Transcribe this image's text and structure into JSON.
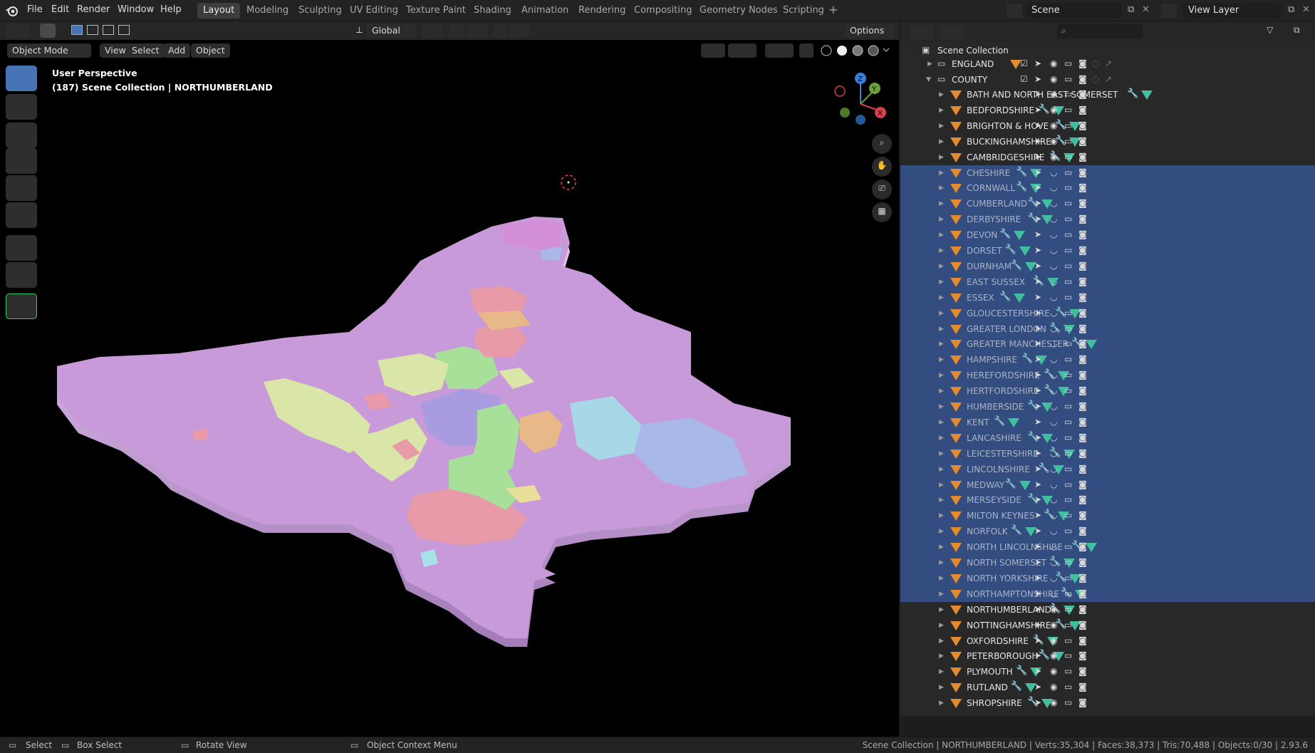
{
  "menu": {
    "file": "File",
    "edit": "Edit",
    "render": "Render",
    "window": "Window",
    "help": "Help"
  },
  "workspaces": [
    "Layout",
    "Modeling",
    "Sculpting",
    "UV Editing",
    "Texture Paint",
    "Shading",
    "Animation",
    "Rendering",
    "Compositing",
    "Geometry Nodes",
    "Scripting"
  ],
  "active_workspace": "Layout",
  "scene": {
    "label": "Scene",
    "view_layer": "View Layer"
  },
  "viewport_header": {
    "transform_orientation": "Global",
    "options": "Options",
    "mode": "Object Mode",
    "view": "View",
    "select": "Select",
    "add": "Add",
    "object": "Object"
  },
  "viewport_info": {
    "line1": "User Perspective",
    "line2": "(187) Scene Collection | NORTHUMBERLAND"
  },
  "outliner": {
    "root": "Scene Collection",
    "collections": [
      {
        "name": "ENGLAND"
      },
      {
        "name": "COUNTY"
      }
    ],
    "objects": [
      {
        "name": "BATH AND NORTH EAST SOMERSET",
        "selected": false
      },
      {
        "name": "BEDFORDSHIRE",
        "selected": false
      },
      {
        "name": "BRIGHTON & HOVE",
        "selected": false
      },
      {
        "name": "BUCKINGHAMSHIRE",
        "selected": false
      },
      {
        "name": "CAMBRIDGESHIRE",
        "selected": false
      },
      {
        "name": "CHESHIRE",
        "selected": true
      },
      {
        "name": "CORNWALL",
        "selected": true
      },
      {
        "name": "CUMBERLAND",
        "selected": true
      },
      {
        "name": "DERBYSHIRE",
        "selected": true
      },
      {
        "name": "DEVON",
        "selected": true
      },
      {
        "name": "DORSET",
        "selected": true
      },
      {
        "name": "DURNHAM",
        "selected": true
      },
      {
        "name": "EAST SUSSEX",
        "selected": true
      },
      {
        "name": "ESSEX",
        "selected": true
      },
      {
        "name": "GLOUCESTERSHIRE",
        "selected": true
      },
      {
        "name": "GREATER LONDON",
        "selected": true
      },
      {
        "name": "GREATER MANCHESTER",
        "selected": true
      },
      {
        "name": "HAMPSHIRE",
        "selected": true
      },
      {
        "name": "HEREFORDSHIRE",
        "selected": true
      },
      {
        "name": "HERTFORDSHIRE",
        "selected": true
      },
      {
        "name": "HUMBERSIDE",
        "selected": true
      },
      {
        "name": "KENT",
        "selected": true
      },
      {
        "name": "LANCASHIRE",
        "selected": true
      },
      {
        "name": "LEICESTERSHIRE",
        "selected": true
      },
      {
        "name": "LINCOLNSHIRE",
        "selected": true
      },
      {
        "name": "MEDWAY",
        "selected": true
      },
      {
        "name": "MERSEYSIDE",
        "selected": true
      },
      {
        "name": "MILTON KEYNES",
        "selected": true
      },
      {
        "name": "NORFOLK",
        "selected": true
      },
      {
        "name": "NORTH LINCOLNSHIRE",
        "selected": true
      },
      {
        "name": "NORTH SOMERSET",
        "selected": true
      },
      {
        "name": "NORTH YORKSHIRE",
        "selected": true
      },
      {
        "name": "NORTHAMPTONSHIRE",
        "selected": true
      },
      {
        "name": "NORTHUMBERLAND",
        "selected": false
      },
      {
        "name": "NOTTINGHAMSHIRE",
        "selected": false
      },
      {
        "name": "OXFORDSHIRE",
        "selected": false
      },
      {
        "name": "PETERBOROUGH",
        "selected": false
      },
      {
        "name": "PLYMOUTH",
        "selected": false
      },
      {
        "name": "RUTLAND",
        "selected": false
      },
      {
        "name": "SHROPSHIRE",
        "selected": false
      }
    ]
  },
  "status": {
    "select": "Select",
    "box_select": "Box Select",
    "rotate_view": "Rotate View",
    "context_menu": "Object Context Menu",
    "stats": "Scene Collection | NORTHUMBERLAND | Verts:35,304 | Faces:38,373 | Tris:70,488 | Objects:0/30 | 2.93.6"
  },
  "colors": {
    "selection_blue": "#334d80",
    "active_tool": "#4772b3",
    "object_orange": "#e58b2f",
    "mesh_teal": "#3fbf9f",
    "map_pink": "#c99ad9"
  }
}
